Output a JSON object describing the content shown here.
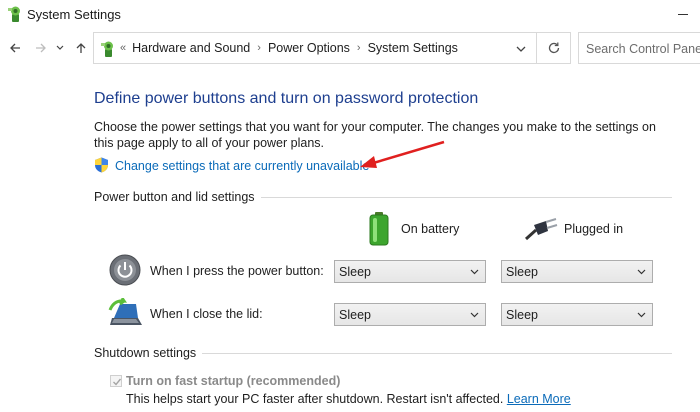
{
  "window": {
    "title": "System Settings"
  },
  "address_bar": {
    "breadcrumbs": [
      "Hardware and Sound",
      "Power Options",
      "System Settings"
    ],
    "search_placeholder": "Search Control Panel"
  },
  "page": {
    "heading": "Define power buttons and turn on password protection",
    "description": "Choose the power settings that you want for your computer. The changes you make to the settings on this page apply to all of your power plans.",
    "change_link": "Change settings that are currently unavailable"
  },
  "power_section": {
    "title": "Power button and lid settings",
    "columns": {
      "battery": "On battery",
      "plugged": "Plugged in"
    },
    "rows": [
      {
        "label": "When I press the power button:",
        "battery_value": "Sleep",
        "plugged_value": "Sleep"
      },
      {
        "label": "When I close the lid:",
        "battery_value": "Sleep",
        "plugged_value": "Sleep"
      }
    ]
  },
  "shutdown_section": {
    "title": "Shutdown settings",
    "fast_startup": {
      "label": "Turn on fast startup (recommended)",
      "checked": true,
      "help_text": "This helps start your PC faster after shutdown. Restart isn't affected.",
      "learn_more": "Learn More"
    }
  },
  "colors": {
    "heading": "#1e3f8f",
    "link": "#0b6bb9",
    "annotation_arrow": "#e0201f"
  },
  "icons": [
    "control-panel-icon",
    "back-arrow-icon",
    "forward-arrow-icon",
    "chevron-down-icon",
    "up-arrow-icon",
    "refresh-icon",
    "shield-icon",
    "battery-icon",
    "power-plug-icon",
    "power-button-icon",
    "laptop-lid-icon",
    "checkmark-icon"
  ]
}
